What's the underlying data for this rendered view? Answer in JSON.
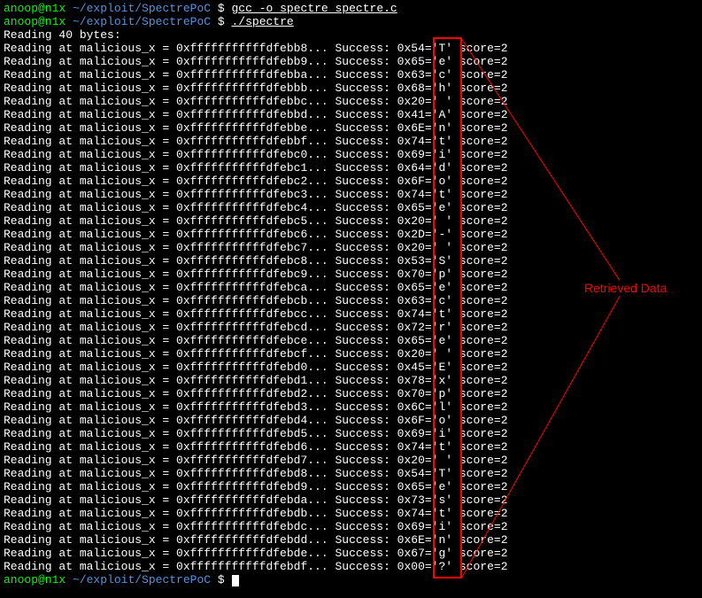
{
  "prompt": {
    "user_host": "anoop@n1x",
    "cwd": "~/exploit/SpectrePoC",
    "symbol": "$"
  },
  "commands": {
    "compile": "gcc -o spectre spectre.c",
    "run": "./spectre"
  },
  "header": "Reading 40 bytes:",
  "rows": [
    {
      "addr": "0xfffffffffffdfebb8",
      "hex": "0x54",
      "ch": "T",
      "score": 2
    },
    {
      "addr": "0xfffffffffffdfebb9",
      "hex": "0x65",
      "ch": "e",
      "score": 2
    },
    {
      "addr": "0xfffffffffffdfebba",
      "hex": "0x63",
      "ch": "c",
      "score": 2
    },
    {
      "addr": "0xfffffffffffdfebbb",
      "hex": "0x68",
      "ch": "h",
      "score": 2
    },
    {
      "addr": "0xfffffffffffdfebbc",
      "hex": "0x20",
      "ch": " ",
      "score": 2
    },
    {
      "addr": "0xfffffffffffdfebbd",
      "hex": "0x41",
      "ch": "A",
      "score": 2
    },
    {
      "addr": "0xfffffffffffdfebbe",
      "hex": "0x6E",
      "ch": "n",
      "score": 2
    },
    {
      "addr": "0xfffffffffffdfebbf",
      "hex": "0x74",
      "ch": "t",
      "score": 2
    },
    {
      "addr": "0xfffffffffffdfebc0",
      "hex": "0x69",
      "ch": "i",
      "score": 2
    },
    {
      "addr": "0xfffffffffffdfebc1",
      "hex": "0x64",
      "ch": "d",
      "score": 2
    },
    {
      "addr": "0xfffffffffffdfebc2",
      "hex": "0x6F",
      "ch": "o",
      "score": 2
    },
    {
      "addr": "0xfffffffffffdfebc3",
      "hex": "0x74",
      "ch": "t",
      "score": 2
    },
    {
      "addr": "0xfffffffffffdfebc4",
      "hex": "0x65",
      "ch": "e",
      "score": 2
    },
    {
      "addr": "0xfffffffffffdfebc5",
      "hex": "0x20",
      "ch": " ",
      "score": 2
    },
    {
      "addr": "0xfffffffffffdfebc6",
      "hex": "0x2D",
      "ch": "-",
      "score": 2
    },
    {
      "addr": "0xfffffffffffdfebc7",
      "hex": "0x20",
      "ch": " ",
      "score": 2
    },
    {
      "addr": "0xfffffffffffdfebc8",
      "hex": "0x53",
      "ch": "S",
      "score": 2
    },
    {
      "addr": "0xfffffffffffdfebc9",
      "hex": "0x70",
      "ch": "p",
      "score": 2
    },
    {
      "addr": "0xfffffffffffdfebca",
      "hex": "0x65",
      "ch": "e",
      "score": 2
    },
    {
      "addr": "0xfffffffffffdfebcb",
      "hex": "0x63",
      "ch": "c",
      "score": 2
    },
    {
      "addr": "0xfffffffffffdfebcc",
      "hex": "0x74",
      "ch": "t",
      "score": 2
    },
    {
      "addr": "0xfffffffffffdfebcd",
      "hex": "0x72",
      "ch": "r",
      "score": 2
    },
    {
      "addr": "0xfffffffffffdfebce",
      "hex": "0x65",
      "ch": "e",
      "score": 2
    },
    {
      "addr": "0xfffffffffffdfebcf",
      "hex": "0x20",
      "ch": " ",
      "score": 2
    },
    {
      "addr": "0xfffffffffffdfebd0",
      "hex": "0x45",
      "ch": "E",
      "score": 2
    },
    {
      "addr": "0xfffffffffffdfebd1",
      "hex": "0x78",
      "ch": "x",
      "score": 2
    },
    {
      "addr": "0xfffffffffffdfebd2",
      "hex": "0x70",
      "ch": "p",
      "score": 2
    },
    {
      "addr": "0xfffffffffffdfebd3",
      "hex": "0x6C",
      "ch": "l",
      "score": 2
    },
    {
      "addr": "0xfffffffffffdfebd4",
      "hex": "0x6F",
      "ch": "o",
      "score": 2
    },
    {
      "addr": "0xfffffffffffdfebd5",
      "hex": "0x69",
      "ch": "i",
      "score": 2
    },
    {
      "addr": "0xfffffffffffdfebd6",
      "hex": "0x74",
      "ch": "t",
      "score": 2
    },
    {
      "addr": "0xfffffffffffdfebd7",
      "hex": "0x20",
      "ch": " ",
      "score": 2
    },
    {
      "addr": "0xfffffffffffdfebd8",
      "hex": "0x54",
      "ch": "T",
      "score": 2
    },
    {
      "addr": "0xfffffffffffdfebd9",
      "hex": "0x65",
      "ch": "e",
      "score": 2
    },
    {
      "addr": "0xfffffffffffdfebda",
      "hex": "0x73",
      "ch": "s",
      "score": 2
    },
    {
      "addr": "0xfffffffffffdfebdb",
      "hex": "0x74",
      "ch": "t",
      "score": 2
    },
    {
      "addr": "0xfffffffffffdfebdc",
      "hex": "0x69",
      "ch": "i",
      "score": 2
    },
    {
      "addr": "0xfffffffffffdfebdd",
      "hex": "0x6E",
      "ch": "n",
      "score": 2
    },
    {
      "addr": "0xfffffffffffdfebde",
      "hex": "0x67",
      "ch": "g",
      "score": 2
    },
    {
      "addr": "0xfffffffffffdfebdf",
      "hex": "0x00",
      "ch": "?",
      "score": 2
    }
  ],
  "annotation": "Retrieved Data"
}
